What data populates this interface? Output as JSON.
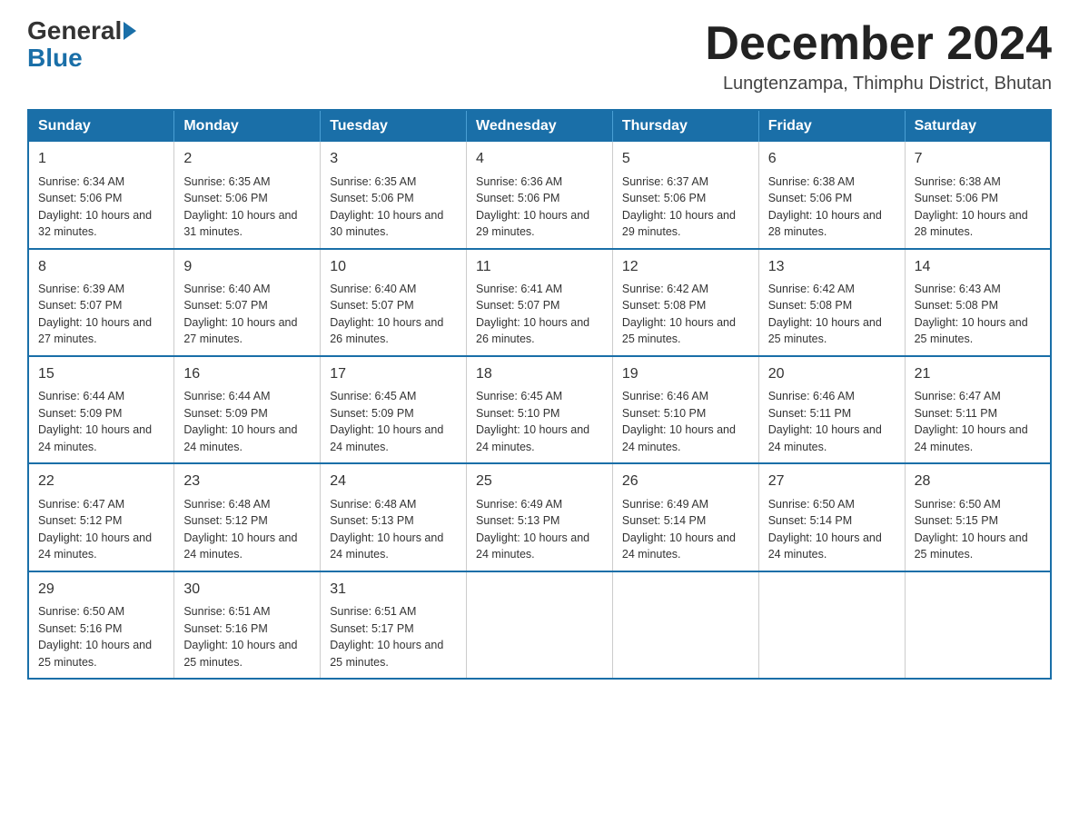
{
  "header": {
    "logo": {
      "general": "General",
      "blue": "Blue"
    },
    "title": "December 2024",
    "location": "Lungtenzampa, Thimphu District, Bhutan"
  },
  "calendar": {
    "days_of_week": [
      "Sunday",
      "Monday",
      "Tuesday",
      "Wednesday",
      "Thursday",
      "Friday",
      "Saturday"
    ],
    "weeks": [
      [
        {
          "day": "1",
          "sunrise": "6:34 AM",
          "sunset": "5:06 PM",
          "daylight": "10 hours and 32 minutes."
        },
        {
          "day": "2",
          "sunrise": "6:35 AM",
          "sunset": "5:06 PM",
          "daylight": "10 hours and 31 minutes."
        },
        {
          "day": "3",
          "sunrise": "6:35 AM",
          "sunset": "5:06 PM",
          "daylight": "10 hours and 30 minutes."
        },
        {
          "day": "4",
          "sunrise": "6:36 AM",
          "sunset": "5:06 PM",
          "daylight": "10 hours and 29 minutes."
        },
        {
          "day": "5",
          "sunrise": "6:37 AM",
          "sunset": "5:06 PM",
          "daylight": "10 hours and 29 minutes."
        },
        {
          "day": "6",
          "sunrise": "6:38 AM",
          "sunset": "5:06 PM",
          "daylight": "10 hours and 28 minutes."
        },
        {
          "day": "7",
          "sunrise": "6:38 AM",
          "sunset": "5:06 PM",
          "daylight": "10 hours and 28 minutes."
        }
      ],
      [
        {
          "day": "8",
          "sunrise": "6:39 AM",
          "sunset": "5:07 PM",
          "daylight": "10 hours and 27 minutes."
        },
        {
          "day": "9",
          "sunrise": "6:40 AM",
          "sunset": "5:07 PM",
          "daylight": "10 hours and 27 minutes."
        },
        {
          "day": "10",
          "sunrise": "6:40 AM",
          "sunset": "5:07 PM",
          "daylight": "10 hours and 26 minutes."
        },
        {
          "day": "11",
          "sunrise": "6:41 AM",
          "sunset": "5:07 PM",
          "daylight": "10 hours and 26 minutes."
        },
        {
          "day": "12",
          "sunrise": "6:42 AM",
          "sunset": "5:08 PM",
          "daylight": "10 hours and 25 minutes."
        },
        {
          "day": "13",
          "sunrise": "6:42 AM",
          "sunset": "5:08 PM",
          "daylight": "10 hours and 25 minutes."
        },
        {
          "day": "14",
          "sunrise": "6:43 AM",
          "sunset": "5:08 PM",
          "daylight": "10 hours and 25 minutes."
        }
      ],
      [
        {
          "day": "15",
          "sunrise": "6:44 AM",
          "sunset": "5:09 PM",
          "daylight": "10 hours and 24 minutes."
        },
        {
          "day": "16",
          "sunrise": "6:44 AM",
          "sunset": "5:09 PM",
          "daylight": "10 hours and 24 minutes."
        },
        {
          "day": "17",
          "sunrise": "6:45 AM",
          "sunset": "5:09 PM",
          "daylight": "10 hours and 24 minutes."
        },
        {
          "day": "18",
          "sunrise": "6:45 AM",
          "sunset": "5:10 PM",
          "daylight": "10 hours and 24 minutes."
        },
        {
          "day": "19",
          "sunrise": "6:46 AM",
          "sunset": "5:10 PM",
          "daylight": "10 hours and 24 minutes."
        },
        {
          "day": "20",
          "sunrise": "6:46 AM",
          "sunset": "5:11 PM",
          "daylight": "10 hours and 24 minutes."
        },
        {
          "day": "21",
          "sunrise": "6:47 AM",
          "sunset": "5:11 PM",
          "daylight": "10 hours and 24 minutes."
        }
      ],
      [
        {
          "day": "22",
          "sunrise": "6:47 AM",
          "sunset": "5:12 PM",
          "daylight": "10 hours and 24 minutes."
        },
        {
          "day": "23",
          "sunrise": "6:48 AM",
          "sunset": "5:12 PM",
          "daylight": "10 hours and 24 minutes."
        },
        {
          "day": "24",
          "sunrise": "6:48 AM",
          "sunset": "5:13 PM",
          "daylight": "10 hours and 24 minutes."
        },
        {
          "day": "25",
          "sunrise": "6:49 AM",
          "sunset": "5:13 PM",
          "daylight": "10 hours and 24 minutes."
        },
        {
          "day": "26",
          "sunrise": "6:49 AM",
          "sunset": "5:14 PM",
          "daylight": "10 hours and 24 minutes."
        },
        {
          "day": "27",
          "sunrise": "6:50 AM",
          "sunset": "5:14 PM",
          "daylight": "10 hours and 24 minutes."
        },
        {
          "day": "28",
          "sunrise": "6:50 AM",
          "sunset": "5:15 PM",
          "daylight": "10 hours and 25 minutes."
        }
      ],
      [
        {
          "day": "29",
          "sunrise": "6:50 AM",
          "sunset": "5:16 PM",
          "daylight": "10 hours and 25 minutes."
        },
        {
          "day": "30",
          "sunrise": "6:51 AM",
          "sunset": "5:16 PM",
          "daylight": "10 hours and 25 minutes."
        },
        {
          "day": "31",
          "sunrise": "6:51 AM",
          "sunset": "5:17 PM",
          "daylight": "10 hours and 25 minutes."
        },
        null,
        null,
        null,
        null
      ]
    ]
  }
}
